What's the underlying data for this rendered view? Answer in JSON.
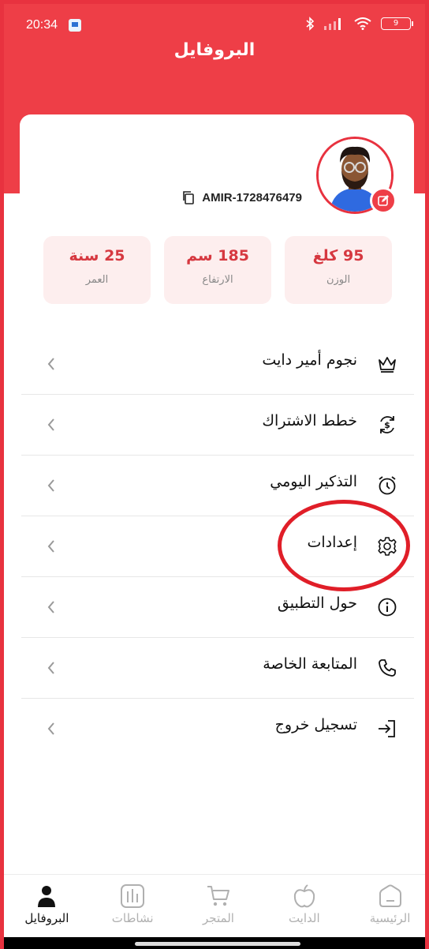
{
  "status_bar": {
    "time": "20:34",
    "battery": "9"
  },
  "header": {
    "title": "البروفايل"
  },
  "profile": {
    "user_id": "AMIR-1728476479",
    "stats": [
      {
        "value": "95 كلغ",
        "label": "الوزن"
      },
      {
        "value": "185 سم",
        "label": "الارتفاع"
      },
      {
        "value": "25 سنة",
        "label": "العمر"
      }
    ]
  },
  "menu": {
    "items": [
      {
        "label": "نجوم أمير دايت",
        "icon": "crown-icon"
      },
      {
        "label": "خطط الاشتراك",
        "icon": "subscription-icon"
      },
      {
        "label": "التذكير اليومي",
        "icon": "alarm-clock-icon"
      },
      {
        "label": "إعدادات",
        "icon": "gear-icon"
      },
      {
        "label": "حول التطبيق",
        "icon": "info-icon"
      },
      {
        "label": "المتابعة الخاصة",
        "icon": "phone-icon"
      },
      {
        "label": "تسجيل خروج",
        "icon": "logout-icon"
      }
    ]
  },
  "bottom_nav": {
    "items": [
      {
        "label": "البروفايل",
        "icon": "profile-icon",
        "active": true
      },
      {
        "label": "نشاطات",
        "icon": "activity-icon",
        "active": false
      },
      {
        "label": "المتجر",
        "icon": "cart-icon",
        "active": false
      },
      {
        "label": "الدايت",
        "icon": "apple-icon",
        "active": false
      },
      {
        "label": "الرئيسية",
        "icon": "home-icon",
        "active": false
      }
    ]
  },
  "colors": {
    "accent": "#ee3e47",
    "stat_bg": "#fdeeee",
    "highlight": "#e01e28"
  }
}
